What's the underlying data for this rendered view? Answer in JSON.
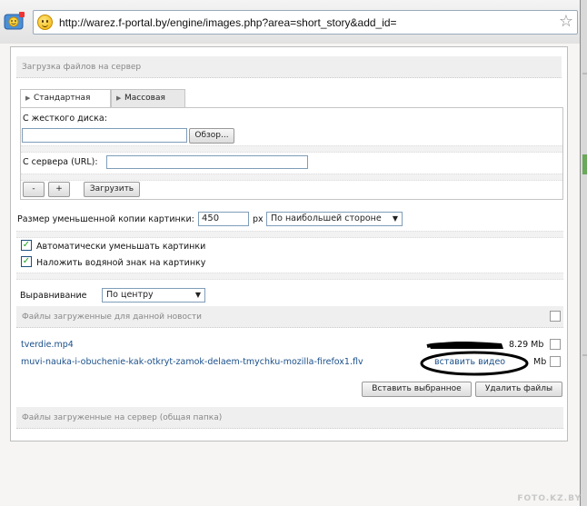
{
  "browser": {
    "url": "http://warez.f-portal.by/engine/images.php?area=short_story&add_id="
  },
  "upload": {
    "header": "Загрузка файлов на сервер",
    "tabs": [
      {
        "label": "Стандартная"
      },
      {
        "label": "Массовая"
      }
    ],
    "from_disk_label": "С жесткого диска:",
    "browse_button": "Обзор...",
    "from_server_label": "С сервера (URL):",
    "url_value": "",
    "file_value": "",
    "minus_button": "-",
    "plus_button": "+",
    "upload_button": "Загрузить"
  },
  "options": {
    "thumb_size_label": "Размер уменьшенной копии картинки:",
    "thumb_size_value": "450",
    "thumb_unit": "px",
    "thumb_side_select": "По наибольшей стороне",
    "auto_resize_label": "Автоматически уменьшать картинки",
    "auto_resize_checked": true,
    "watermark_label": "Наложить водяной знак на картинку",
    "watermark_checked": true,
    "align_label": "Выравнивание",
    "align_select": "По центру"
  },
  "files": {
    "header": "Файлы загруженные для данной новости",
    "items": [
      {
        "name": "tverdie.mp4",
        "size": "8.29 Mb"
      },
      {
        "name": "muvi-nauka-i-obuchenie-kak-otkryt-zamok-delaem-tmychku-mozilla-firefox1.flv",
        "size": "Mb"
      }
    ],
    "insert_video_link": "вставить видео",
    "insert_selected_button": "Вставить выбранное",
    "delete_files_button": "Удалить файлы"
  },
  "server_files": {
    "header": "Файлы загруженные на сервер (общая папка)"
  },
  "watermark_text": "FOTO.KZ.BY"
}
